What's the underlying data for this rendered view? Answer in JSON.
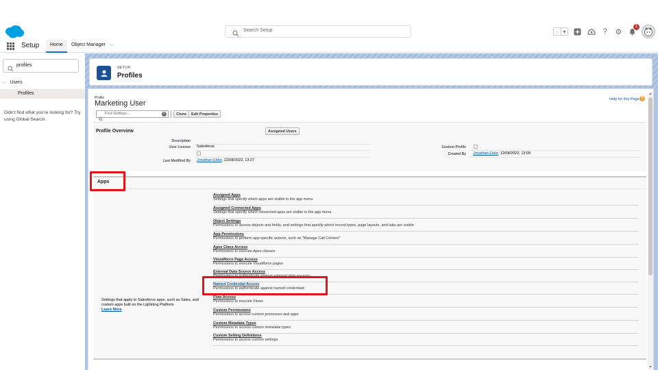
{
  "header": {
    "search_placeholder": "Search Setup",
    "notification_count": "1"
  },
  "app_nav": {
    "app_name": "Setup",
    "tabs": [
      {
        "label": "Home"
      },
      {
        "label": "Object Manager"
      }
    ]
  },
  "sidebar": {
    "quickfind_value": "profiles",
    "tree_parent": "Users",
    "tree_child": "Profiles",
    "help_text": "Didn't find what you're looking for? Try using Global Search."
  },
  "page_header": {
    "eyebrow": "SETUP",
    "title": "Profiles"
  },
  "profile": {
    "record_type": "Profile",
    "name": "Marketing User",
    "help_link": "Help for this Page",
    "find_settings_placeholder": "Find Settings...",
    "buttons": {
      "clone": "Clone",
      "edit_properties": "Edit Properties",
      "assigned_users": "Assigned Users"
    },
    "overview": {
      "title": "Profile Overview",
      "fields": {
        "description_label": "Description",
        "user_license_label": "User License",
        "user_license_value": "Salesforce",
        "custom_profile_label": "Custom Profile",
        "created_by_label": "Created By",
        "created_by_name": "Jonathan Elder",
        "created_by_date": ", 12/08/2022, 13:09",
        "last_modified_label": "Last Modified By",
        "last_modified_name": "Jonathan Elder",
        "last_modified_date": ", 12/08/2022, 13:27"
      }
    },
    "apps": {
      "title": "Apps",
      "description": "Settings that apply to Salesforce apps, such as Sales, and custom apps built on the Lightning Platform",
      "learn_more": "Learn More",
      "items": [
        {
          "title": "Assigned Apps",
          "desc": "Settings that specify which apps are visible in the app menu"
        },
        {
          "title": "Assigned Connected Apps",
          "desc": "Settings that specify which connected apps are visible in the app menu"
        },
        {
          "title": "Object Settings",
          "desc": "Permissions to access objects and fields, and settings that specify which record types, page layouts, and tabs are visible"
        },
        {
          "title": "App Permissions",
          "desc": "Permissions to perform app-specific actions, such as \"Manage Call Centers\""
        },
        {
          "title": "Apex Class Access",
          "desc": "Permissions to execute Apex classes"
        },
        {
          "title": "Visualforce Page Access",
          "desc": "Permissions to execute Visualforce pages"
        },
        {
          "title": "External Data Source Access",
          "desc": "Permissions to authenticate against external data sources"
        },
        {
          "title": "Named Credential Access",
          "desc": "Permissions to authenticate against named credentials"
        },
        {
          "title": "Flow Access",
          "desc": "Permissions to execute Flows"
        },
        {
          "title": "Custom Permissions",
          "desc": "Permissions to access custom processes and apps"
        },
        {
          "title": "Custom Metadata Types",
          "desc": "Permissions to access custom metadata types"
        },
        {
          "title": "Custom Setting Definitions",
          "desc": "Permissions to access custom settings"
        }
      ]
    }
  },
  "colors": {
    "brand_blue": "#0176d3",
    "link_blue": "#015ba7",
    "annotation_red": "#e3121b"
  }
}
